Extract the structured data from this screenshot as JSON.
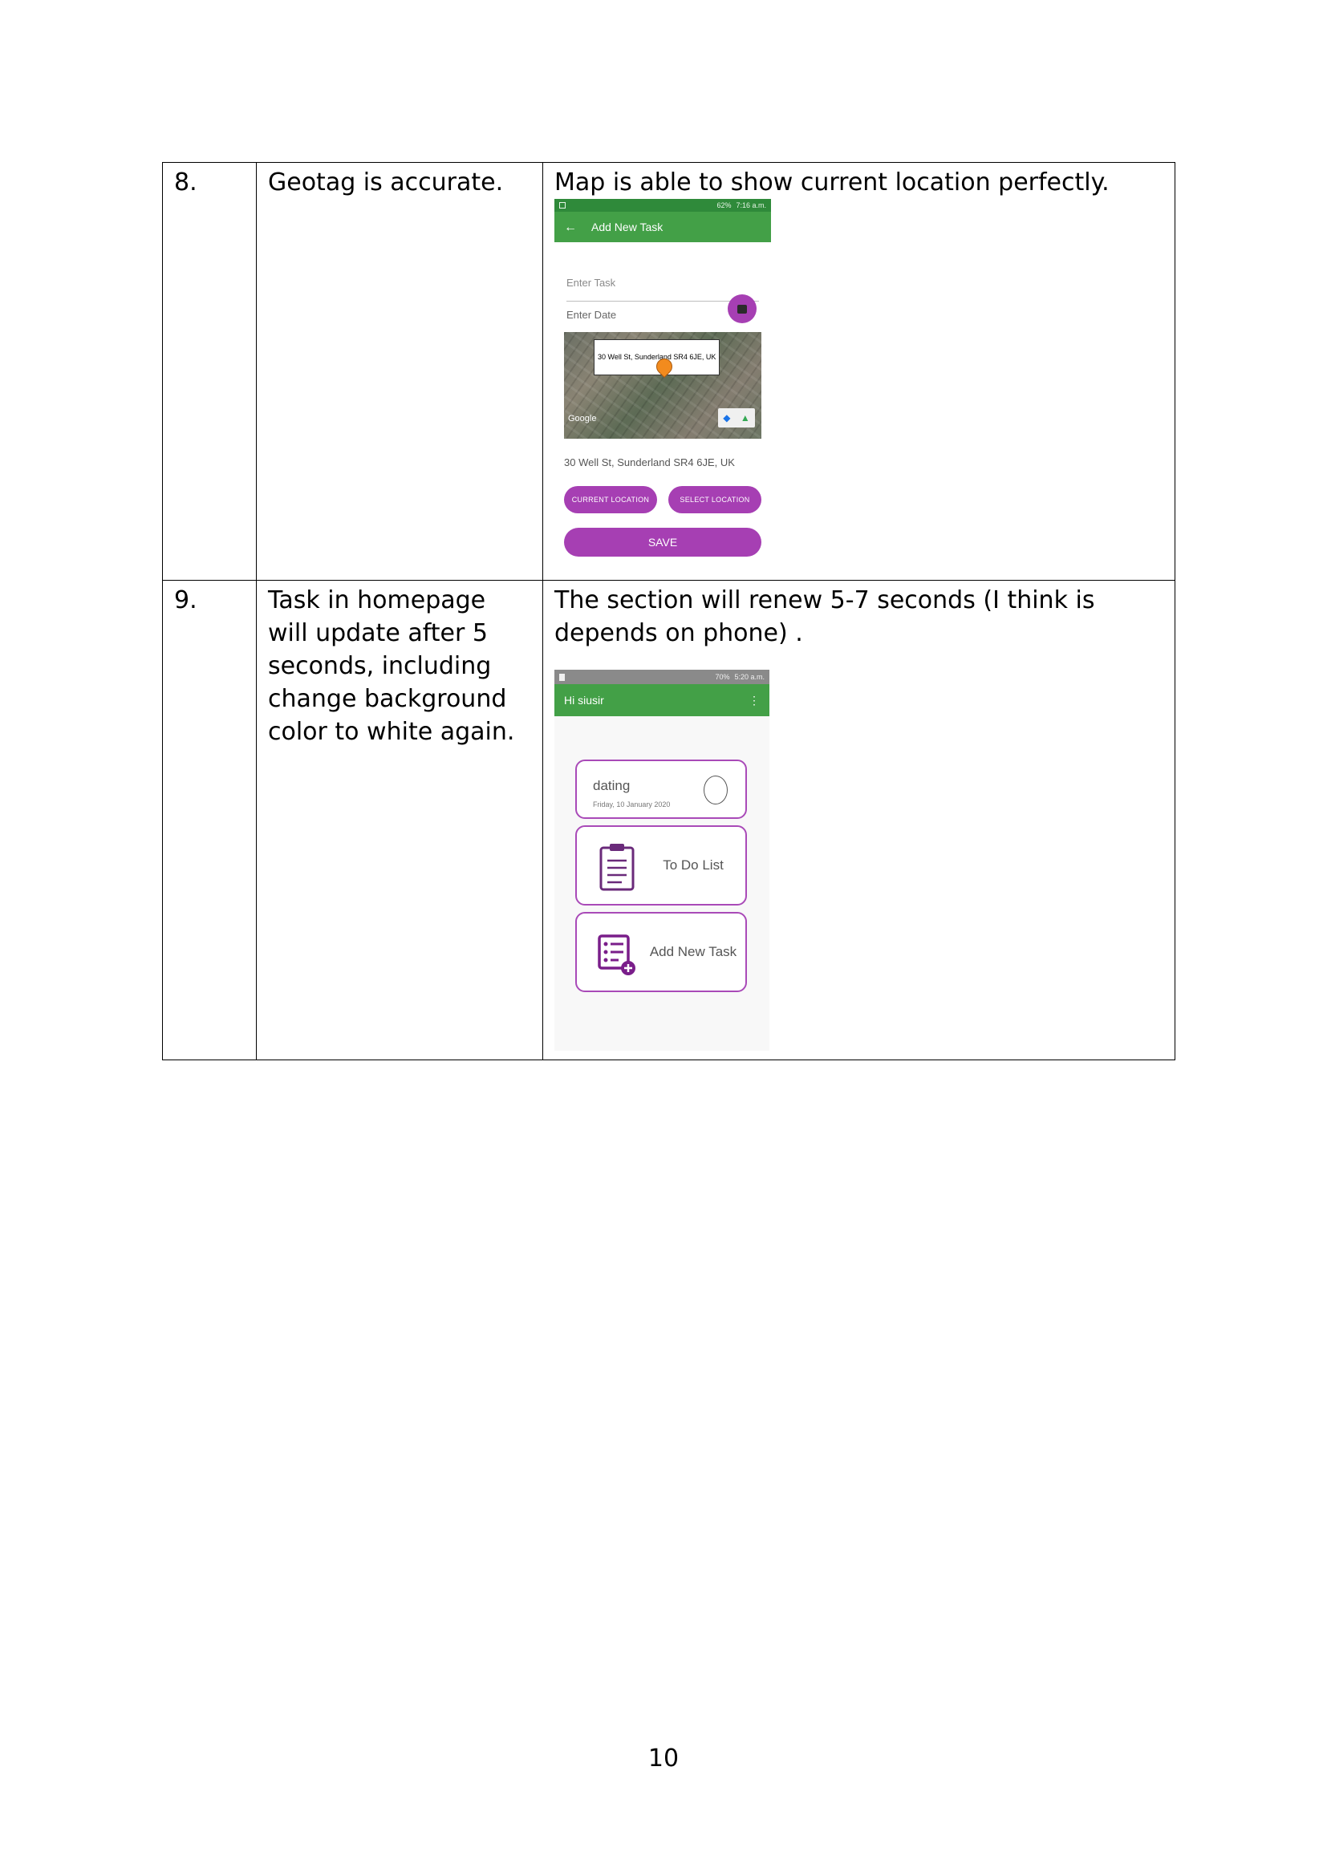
{
  "rows": [
    {
      "number": "8.",
      "test": "Geotag is accurate.",
      "result": "Map is able to show current location perfectly.",
      "phone": {
        "status_time": "7:16 a.m.",
        "status_battery": "62%",
        "appbar_title": "Add New Task",
        "task_placeholder": "Enter Task",
        "date_placeholder": "Enter Date",
        "map_label": "30 Well St, Sunderland SR4 6JE, UK",
        "map_attribution": "Google",
        "address": "30 Well St, Sunderland SR4 6JE, UK",
        "current_location_label": "CURRENT LOCATION",
        "select_location_label": "SELECT LOCATION",
        "save_label": "SAVE"
      }
    },
    {
      "number": "9.",
      "test": "Task in homepage will update after 5 seconds, including change background color to white again.",
      "result": "The section will renew 5-7 seconds (I think is depends on phone) .",
      "phone": {
        "status_time": "5:20 a.m.",
        "status_battery": "70%",
        "appbar_title": "Hi siusir",
        "task_title": "dating",
        "task_date": "Friday, 10 January 2020",
        "todo_label": "To Do List",
        "add_task_label": "Add New Task"
      }
    }
  ],
  "page_number": "10",
  "colors": {
    "appbar": "#43a047",
    "accent": "#a63fb3",
    "card_border": "#a94ab8"
  }
}
